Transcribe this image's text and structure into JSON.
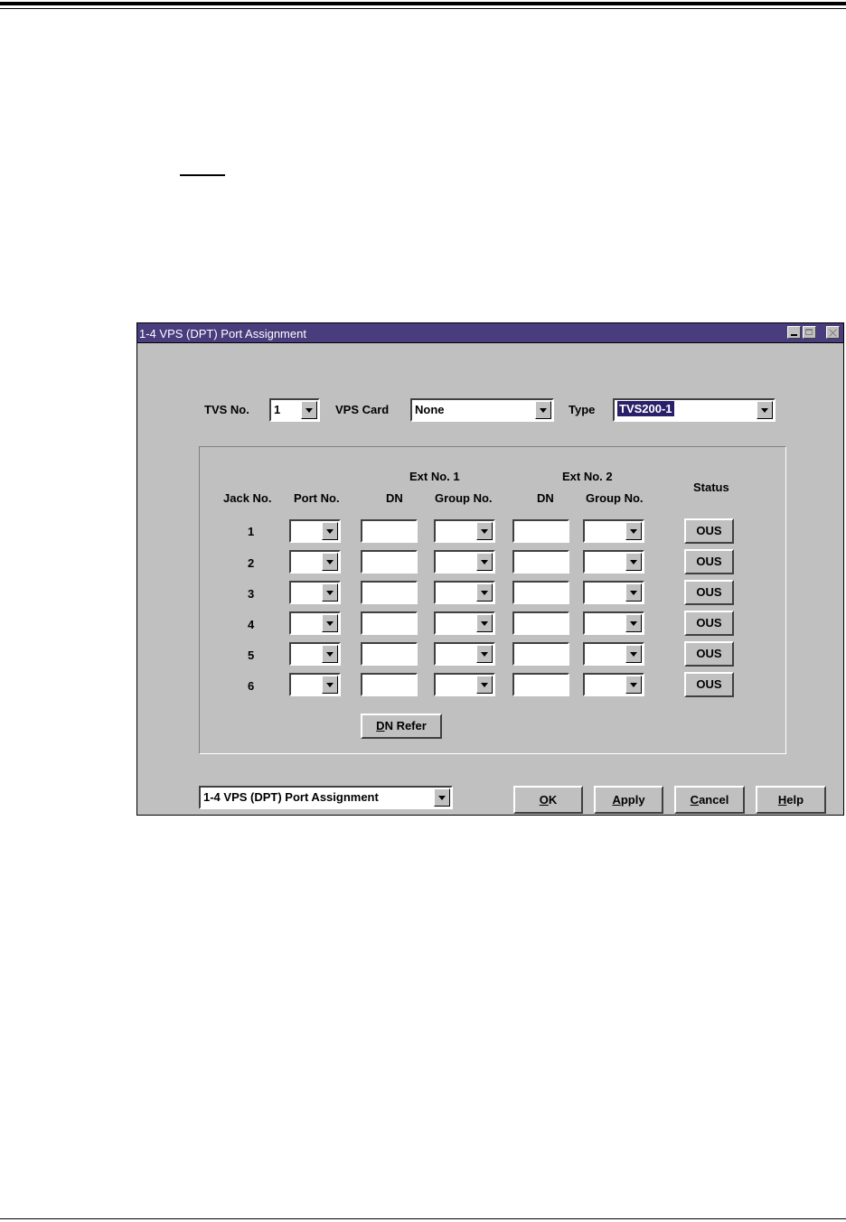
{
  "window": {
    "title": "1-4 VPS (DPT) Port Assignment"
  },
  "top_controls": {
    "tvs_no_label": "TVS No.",
    "tvs_no_value": "1",
    "vps_card_label": "VPS Card",
    "vps_card_value": "None",
    "type_label": "Type",
    "type_value": "TVS200-1"
  },
  "table": {
    "headers": {
      "jack_no": "Jack No.",
      "port_no": "Port No.",
      "ext1_group": "Ext No. 1",
      "ext1_dn": "DN",
      "ext1_group_no": "Group No.",
      "ext2_group": "Ext No. 2",
      "ext2_dn": "DN",
      "ext2_group_no": "Group No.",
      "status": "Status"
    },
    "rows": [
      {
        "jack": "1",
        "status": "OUS"
      },
      {
        "jack": "2",
        "status": "OUS"
      },
      {
        "jack": "3",
        "status": "OUS"
      },
      {
        "jack": "4",
        "status": "OUS"
      },
      {
        "jack": "5",
        "status": "OUS"
      },
      {
        "jack": "6",
        "status": "OUS"
      }
    ]
  },
  "buttons": {
    "dn_refer": "DN Refer",
    "ok": "OK",
    "apply": "Apply",
    "cancel": "Cancel",
    "help": "Help"
  },
  "footer": {
    "screen_select_value": "1-4 VPS (DPT) Port Assignment"
  },
  "colors": {
    "titlebar": "#4a3d7e",
    "window_face": "#c0c0c0",
    "selection": "#2a1f6b"
  }
}
